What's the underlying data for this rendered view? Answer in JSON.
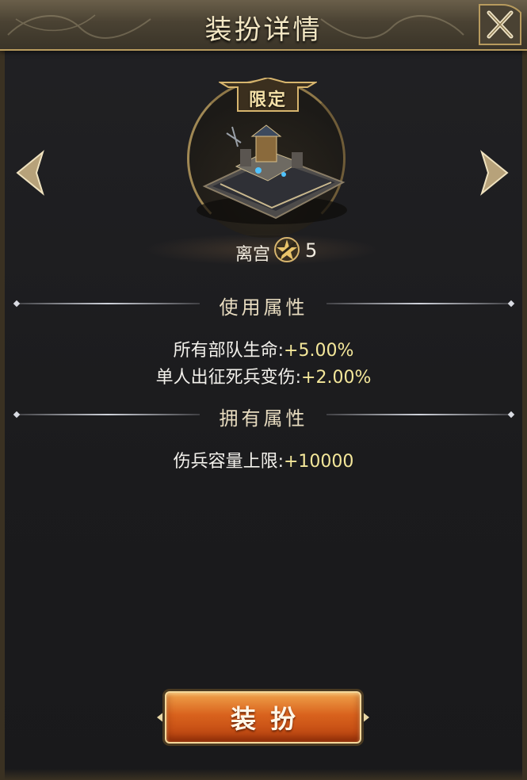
{
  "header": {
    "title": "装扮详情",
    "close_icon": "close-x-icon"
  },
  "skin": {
    "tag": "限定",
    "name": "离宫",
    "star_icon": "star-badge-icon",
    "star_level": "5",
    "image": "palace-icon"
  },
  "sections": {
    "use_attrs": {
      "title": "使用属性",
      "items": [
        {
          "label": "所有部队生命:",
          "value": "+5.00%"
        },
        {
          "label": "单人出征死兵变伤:",
          "value": "+2.00%"
        }
      ]
    },
    "own_attrs": {
      "title": "拥有属性",
      "items": [
        {
          "label": "伤兵容量上限:",
          "value": "+10000"
        }
      ]
    }
  },
  "action": {
    "equip_label": "装扮"
  },
  "colors": {
    "gold": "#f3e7c4",
    "value_yellow": "#f4e79a",
    "button_orange": "#d9621d"
  }
}
